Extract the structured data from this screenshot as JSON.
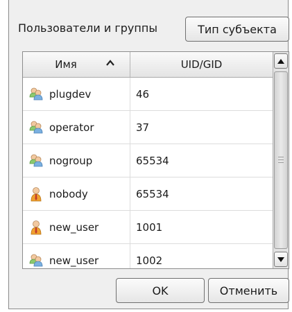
{
  "dialog": {
    "label": "Пользователи и группы",
    "type_button": "Тип субъекта"
  },
  "table": {
    "columns": [
      "Имя",
      "UID/GID"
    ],
    "sort": "ascending",
    "rows": [
      {
        "name": "plugdev",
        "id": "46",
        "kind": "group"
      },
      {
        "name": "operator",
        "id": "37",
        "kind": "group"
      },
      {
        "name": "nogroup",
        "id": "65534",
        "kind": "group"
      },
      {
        "name": "nobody",
        "id": "65534",
        "kind": "user"
      },
      {
        "name": "new_user",
        "id": "1001",
        "kind": "user"
      },
      {
        "name": "new_user",
        "id": "1002",
        "kind": "group"
      }
    ]
  },
  "buttons": {
    "ok": "OK",
    "cancel": "Отменить"
  },
  "icons": {
    "group": "group-users-icon",
    "user": "user-icon",
    "sort": "chevron-up-icon"
  }
}
